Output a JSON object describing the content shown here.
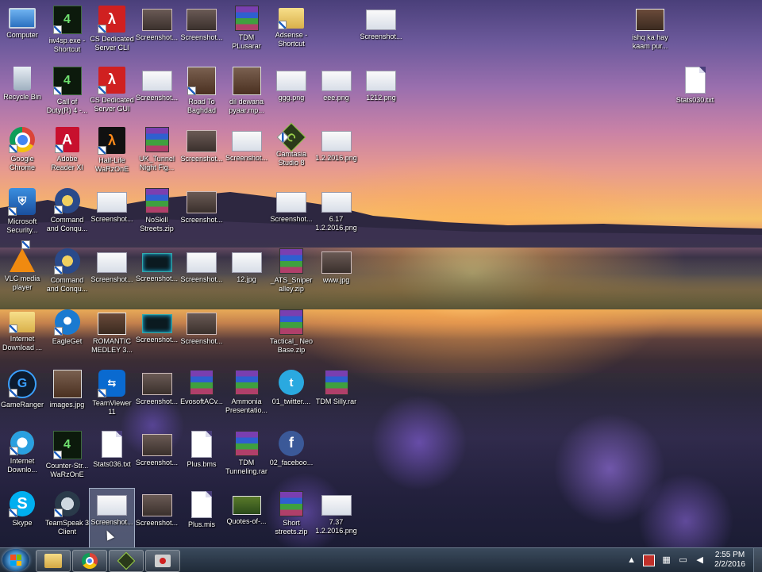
{
  "desktop": {
    "icons": [
      {
        "label": "Computer",
        "glyph": "computer-icon",
        "col": 0,
        "row": 0,
        "shortcut": false
      },
      {
        "label": "Recycle Bin",
        "glyph": "recycle-bin-icon",
        "col": 0,
        "row": 1,
        "shortcut": false
      },
      {
        "label": "Google Chrome",
        "glyph": "chrome-icon",
        "col": 0,
        "row": 2,
        "shortcut": true
      },
      {
        "label": "Microsoft Security...",
        "glyph": "security-icon",
        "col": 0,
        "row": 3,
        "shortcut": true
      },
      {
        "label": "VLC media player",
        "glyph": "vlc-icon",
        "col": 0,
        "row": 4,
        "shortcut": true
      },
      {
        "label": "Internet Download ...",
        "glyph": "folder-icon",
        "col": 0,
        "row": 5,
        "shortcut": true
      },
      {
        "label": "GameRanger",
        "glyph": "gameranger-icon",
        "col": 0,
        "row": 6,
        "shortcut": true
      },
      {
        "label": "Internet Downlo...",
        "glyph": "ie-icon",
        "col": 0,
        "row": 7,
        "shortcut": true
      },
      {
        "label": "Skype",
        "glyph": "skype-icon",
        "col": 0,
        "row": 8,
        "shortcut": true
      },
      {
        "label": "iw4sp.exe - Shortcut",
        "glyph": "cs-icon",
        "col": 1,
        "row": 0,
        "shortcut": true
      },
      {
        "label": "Call of Duty(R) 4 -...",
        "glyph": "cs-icon",
        "col": 1,
        "row": 1,
        "shortcut": true
      },
      {
        "label": "Adobe Reader XI",
        "glyph": "pdf-icon",
        "col": 1,
        "row": 2,
        "shortcut": true
      },
      {
        "label": "Command and Conqu...",
        "glyph": "cnc-icon",
        "col": 1,
        "row": 3,
        "shortcut": true
      },
      {
        "label": "Command and Conqu...",
        "glyph": "cnc-icon",
        "col": 1,
        "row": 4,
        "shortcut": true
      },
      {
        "label": "EagleGet",
        "glyph": "eagleget-icon",
        "col": 1,
        "row": 5,
        "shortcut": true
      },
      {
        "label": "images.jpg",
        "glyph": "photo-icon",
        "col": 1,
        "row": 6,
        "shortcut": false
      },
      {
        "label": "Counter-Str... WaRzOnE",
        "glyph": "cs-icon",
        "col": 1,
        "row": 7,
        "shortcut": true
      },
      {
        "label": "TeamSpeak 3 Client",
        "glyph": "teamspeak-icon",
        "col": 1,
        "row": 8,
        "shortcut": true
      },
      {
        "label": "CS Dedicated Server CLI",
        "glyph": "halflife-icon",
        "col": 2,
        "row": 0,
        "shortcut": true
      },
      {
        "label": "CS Dedicated Server GUI",
        "glyph": "halflife-icon",
        "col": 2,
        "row": 1,
        "shortcut": true
      },
      {
        "label": "Half-Life WaRzOnE",
        "glyph": "halflife2-icon",
        "col": 2,
        "row": 2,
        "shortcut": true
      },
      {
        "label": "Screenshot...",
        "glyph": "screenshot-light-icon",
        "col": 2,
        "row": 3,
        "shortcut": false
      },
      {
        "label": "Screenshot...",
        "glyph": "screenshot-light-icon",
        "col": 2,
        "row": 4,
        "shortcut": false
      },
      {
        "label": "ROMANTIC MEDLEY 3...",
        "glyph": "video-icon",
        "col": 2,
        "row": 5,
        "shortcut": false
      },
      {
        "label": "TeamViewer 11",
        "glyph": "teamviewer-icon",
        "col": 2,
        "row": 6,
        "shortcut": true
      },
      {
        "label": "Stats036.txt",
        "glyph": "file-icon",
        "col": 2,
        "row": 7,
        "shortcut": false
      },
      {
        "label": "Screenshot...",
        "glyph": "screenshot-light-icon",
        "col": 2,
        "row": 8,
        "shortcut": false,
        "selected": true
      },
      {
        "label": "Screenshot...",
        "glyph": "screenshot-icon",
        "col": 3,
        "row": 0,
        "shortcut": false
      },
      {
        "label": "Screenshot...",
        "glyph": "screenshot-light-icon",
        "col": 3,
        "row": 1,
        "shortcut": false
      },
      {
        "label": "UK_Tunnel Night Fig...",
        "glyph": "rar-icon",
        "col": 3,
        "row": 2,
        "shortcut": false
      },
      {
        "label": "NoSkill Streets.zip",
        "glyph": "rar-icon",
        "col": 3,
        "row": 3,
        "shortcut": false
      },
      {
        "label": "Screenshot...",
        "glyph": "screenshot-teal-icon",
        "col": 3,
        "row": 4,
        "shortcut": false
      },
      {
        "label": "Screenshot...",
        "glyph": "screenshot-teal-icon",
        "col": 3,
        "row": 5,
        "shortcut": false
      },
      {
        "label": "Screenshot...",
        "glyph": "screenshot-icon",
        "col": 3,
        "row": 6,
        "shortcut": false
      },
      {
        "label": "Screenshot...",
        "glyph": "screenshot-icon",
        "col": 3,
        "row": 7,
        "shortcut": false
      },
      {
        "label": "Screenshot...",
        "glyph": "screenshot-icon",
        "col": 3,
        "row": 8,
        "shortcut": false
      },
      {
        "label": "Screenshot...",
        "glyph": "screenshot-icon",
        "col": 4,
        "row": 0,
        "shortcut": false
      },
      {
        "label": "Road To Baghdad",
        "glyph": "photo-icon",
        "col": 4,
        "row": 1,
        "shortcut": true
      },
      {
        "label": "Screenshot...",
        "glyph": "screenshot-icon",
        "col": 4,
        "row": 2,
        "shortcut": false
      },
      {
        "label": "Screenshot...",
        "glyph": "screenshot-icon",
        "col": 4,
        "row": 3,
        "shortcut": false
      },
      {
        "label": "Screenshot...",
        "glyph": "screenshot-light-icon",
        "col": 4,
        "row": 4,
        "shortcut": false
      },
      {
        "label": "Screenshot...",
        "glyph": "screenshot-icon",
        "col": 4,
        "row": 5,
        "shortcut": false
      },
      {
        "label": "EvosoftACv...",
        "glyph": "rar-icon",
        "col": 4,
        "row": 6,
        "shortcut": false
      },
      {
        "label": "Plus.bms",
        "glyph": "file-icon",
        "col": 4,
        "row": 7,
        "shortcut": false
      },
      {
        "label": "Plus.mis",
        "glyph": "file-icon",
        "col": 4,
        "row": 8,
        "shortcut": false
      },
      {
        "label": "TDM PLusarar",
        "glyph": "rar-icon",
        "col": 5,
        "row": 0,
        "shortcut": false
      },
      {
        "label": "dil dewana pyaar.mp...",
        "glyph": "photo-icon",
        "col": 5,
        "row": 1,
        "shortcut": false
      },
      {
        "label": "Screenshot...",
        "glyph": "screenshot-light-icon",
        "col": 5,
        "row": 2,
        "shortcut": false
      },
      {
        "label": "12.jpg",
        "glyph": "screenshot-light-icon",
        "col": 5,
        "row": 4,
        "shortcut": false
      },
      {
        "label": "Ammonia Presentatio...",
        "glyph": "rar-icon",
        "col": 5,
        "row": 6,
        "shortcut": false
      },
      {
        "label": "TDM Tunneling.rar",
        "glyph": "rar-icon",
        "col": 5,
        "row": 7,
        "shortcut": false
      },
      {
        "label": "Quotes-of-...",
        "glyph": "quotes-icon",
        "col": 5,
        "row": 8,
        "shortcut": false
      },
      {
        "label": "Adsense - Shortcut",
        "glyph": "folder-icon",
        "col": 6,
        "row": 0,
        "shortcut": true
      },
      {
        "label": "ggg.png",
        "glyph": "screenshot-light-icon",
        "col": 6,
        "row": 1,
        "shortcut": false
      },
      {
        "label": "Camtasia Studio 8",
        "glyph": "camtasia-icon",
        "col": 6,
        "row": 2,
        "shortcut": true
      },
      {
        "label": "Screenshot...",
        "glyph": "screenshot-light-icon",
        "col": 6,
        "row": 3,
        "shortcut": false
      },
      {
        "label": "_ATS_Sniper alley.zip",
        "glyph": "rar-icon",
        "col": 6,
        "row": 4,
        "shortcut": false
      },
      {
        "label": "Tactical_ Neo Base.zip",
        "glyph": "rar-icon",
        "col": 6,
        "row": 5,
        "shortcut": false
      },
      {
        "label": "01_twitter....",
        "glyph": "twitter-icon",
        "col": 6,
        "row": 6,
        "shortcut": false
      },
      {
        "label": "02_faceboo...",
        "glyph": "facebook-icon",
        "col": 6,
        "row": 7,
        "shortcut": false
      },
      {
        "label": "Short streets.zip",
        "glyph": "rar-icon",
        "col": 6,
        "row": 8,
        "shortcut": false
      },
      {
        "label": "eee.png",
        "glyph": "screenshot-light-icon",
        "col": 7,
        "row": 1,
        "shortcut": false
      },
      {
        "label": "1.2.2016.png",
        "glyph": "screenshot-light-icon",
        "col": 7,
        "row": 2,
        "shortcut": false
      },
      {
        "label": "6.17 1.2.2016.png",
        "glyph": "screenshot-light-icon",
        "col": 7,
        "row": 3,
        "shortcut": false
      },
      {
        "label": "www.jpg",
        "glyph": "screenshot-icon",
        "col": 7,
        "row": 4,
        "shortcut": false
      },
      {
        "label": "TDM Silly.rar",
        "glyph": "rar-icon",
        "col": 7,
        "row": 6,
        "shortcut": false
      },
      {
        "label": "7.37 1.2.2016.png",
        "glyph": "screenshot-light-icon",
        "col": 7,
        "row": 8,
        "shortcut": false
      },
      {
        "label": "Screenshot...",
        "glyph": "screenshot-light-icon",
        "col": 8,
        "row": 0,
        "shortcut": false
      },
      {
        "label": "1212.png",
        "glyph": "screenshot-light-icon",
        "col": 8,
        "row": 1,
        "shortcut": false
      },
      {
        "label": "ishq ka hay kaam pur...",
        "glyph": "video-icon",
        "col": 14,
        "row": 0,
        "shortcut": false
      },
      {
        "label": "Stats030.txt",
        "glyph": "file-icon",
        "col": 15,
        "row": 1,
        "shortcut": false
      }
    ]
  },
  "taskbar": {
    "pinned": [
      {
        "name": "explorer",
        "glyph": "folder-icon"
      },
      {
        "name": "chrome",
        "glyph": "chrome-icon"
      },
      {
        "name": "camtasia",
        "glyph": "camtasia-icon"
      },
      {
        "name": "recorder",
        "glyph": "recorder-icon"
      }
    ],
    "tray_icons": [
      "chevron-up-icon",
      "flag-icon",
      "network-icon",
      "monitor-icon",
      "volume-icon"
    ],
    "clock": {
      "time": "2:55 PM",
      "date": "2/2/2016"
    }
  }
}
